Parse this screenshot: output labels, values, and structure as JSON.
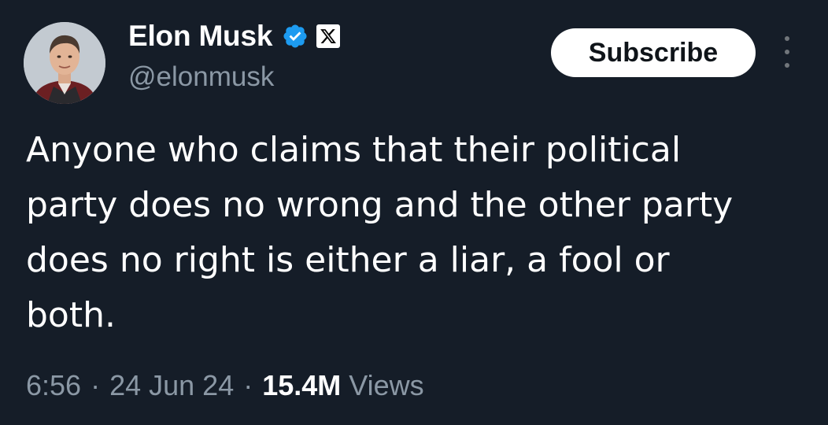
{
  "author": {
    "display_name": "Elon Musk",
    "handle": "@elonmusk",
    "verified_badge_color": "#1d9bf0",
    "avatar_icon": "profile-photo",
    "affiliate_icon": "x-logo-icon"
  },
  "actions": {
    "subscribe_label": "Subscribe",
    "more_icon": "more-vertical-icon"
  },
  "tweet": {
    "text_lines": [
      "Anyone who claims that their political",
      "party does no wrong and the other party",
      "does no right is either a liar, a fool or",
      "both."
    ]
  },
  "meta": {
    "time": "6:56",
    "separator": "·",
    "date": "24 Jun 24",
    "views_count": "15.4M",
    "views_label": "Views"
  },
  "colors": {
    "background": "#151d28",
    "text_primary": "#ffffff",
    "text_secondary": "#8b98a5",
    "button_bg": "#ffffff",
    "button_text": "#0f1419"
  }
}
